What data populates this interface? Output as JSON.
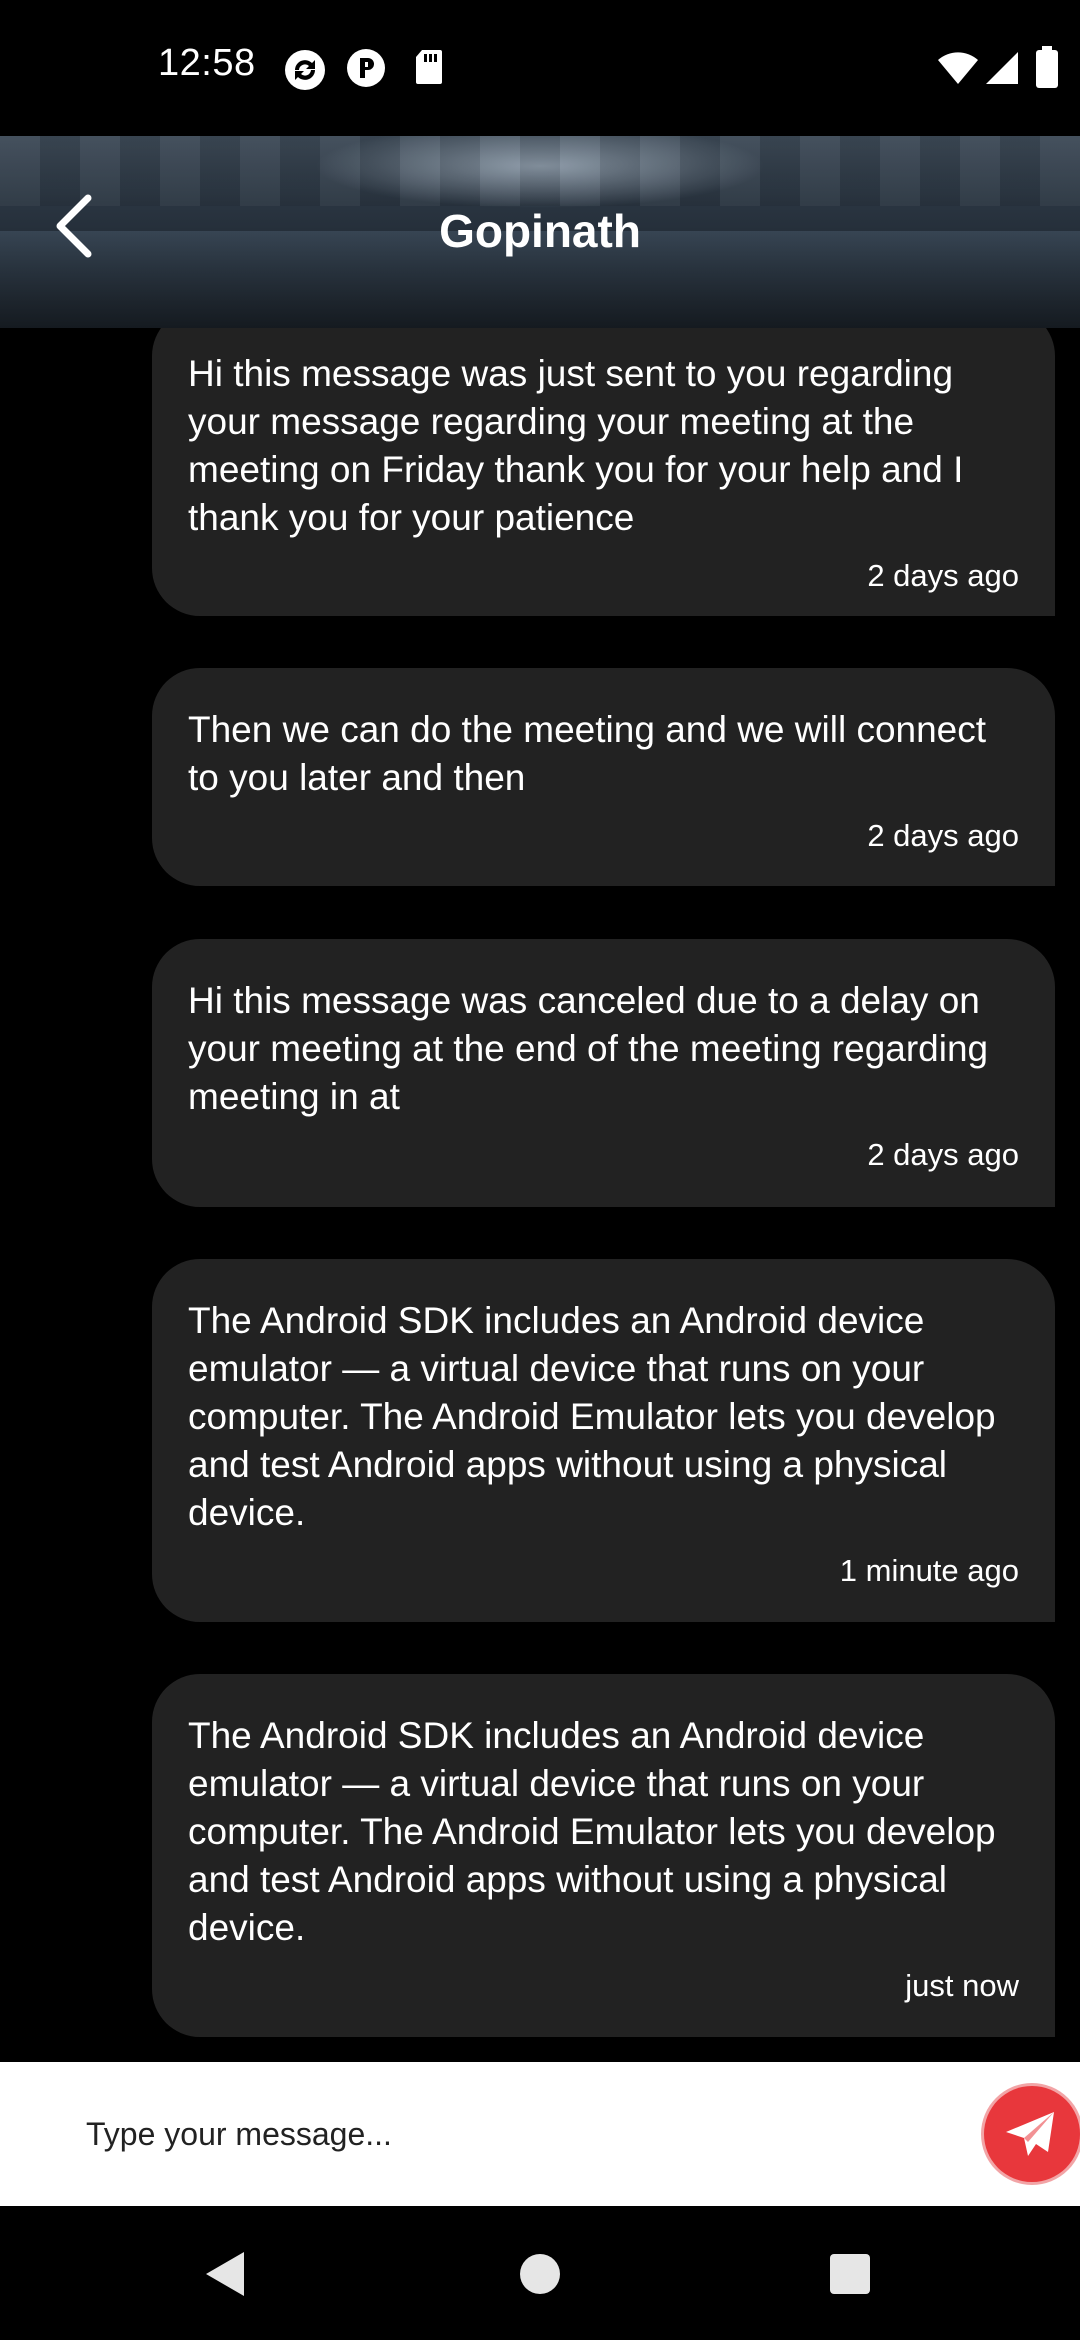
{
  "status_bar": {
    "time": "12:58",
    "left_icons": [
      "sync-icon",
      "app-p-icon",
      "sd-card-icon"
    ],
    "right_icons": [
      "wifi-icon",
      "signal-icon",
      "battery-icon"
    ]
  },
  "header": {
    "title": "Gopinath",
    "back_icon": "chevron-left-icon"
  },
  "messages": [
    {
      "text": "Hi this message was just sent to you regarding your message regarding your meeting at the meeting on Friday thank you for your help and I thank you for your patience",
      "time": "2 days ago"
    },
    {
      "text": "Then we can do the meeting and we will connect to you later and then",
      "time": "2 days ago"
    },
    {
      "text": "Hi this message was canceled due to a delay on your meeting at the end of the meeting regarding meeting in at",
      "time": "2 days ago"
    },
    {
      "text": "The Android SDK includes an Android device emulator — a virtual device that runs on your computer. The Android Emulator lets you develop and test Android apps without using a physical device.",
      "time": "1 minute ago"
    },
    {
      "text": "The Android SDK includes an Android device emulator — a virtual device that runs on your computer. The Android Emulator lets you develop and test Android apps without using a physical device.",
      "time": "just now"
    }
  ],
  "composer": {
    "placeholder": "Type your message...",
    "value": "",
    "send_icon": "paper-plane-icon"
  },
  "nav_bar": {
    "icons": [
      "nav-back-icon",
      "nav-home-icon",
      "nav-recents-icon"
    ]
  },
  "colors": {
    "background": "#000000",
    "bubble": "#222222",
    "send_button": "#e8373c",
    "text": "#ffffff"
  }
}
